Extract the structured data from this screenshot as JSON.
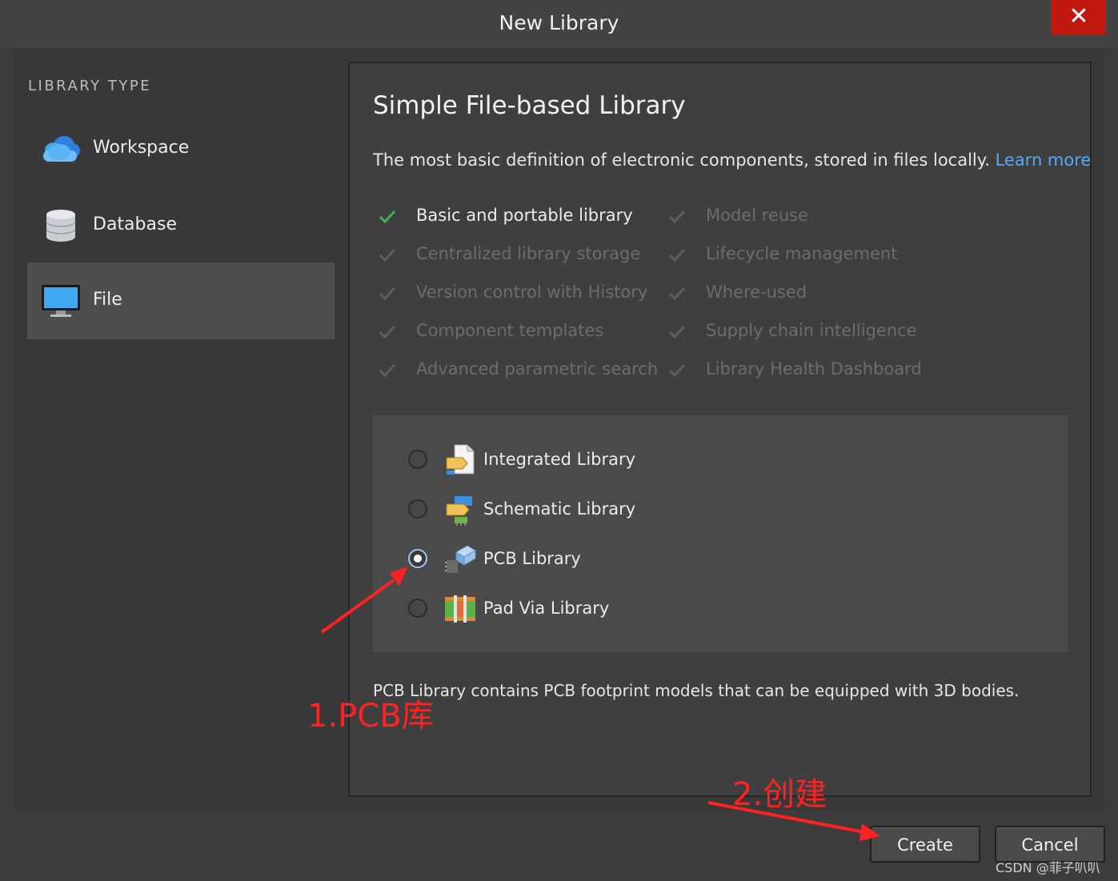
{
  "window": {
    "title": "New Library",
    "close_glyph": "✕"
  },
  "sidebar": {
    "heading": "LIBRARY TYPE",
    "items": [
      {
        "label": "Workspace",
        "icon": "cloud-icon",
        "selected": false
      },
      {
        "label": "Database",
        "icon": "database-icon",
        "selected": false
      },
      {
        "label": "File",
        "icon": "monitor-icon",
        "selected": true
      }
    ]
  },
  "panel": {
    "title": "Simple File-based Library",
    "description": "The most basic definition of electronic components, stored in files locally.",
    "learn_more": "Learn more",
    "features_left": [
      {
        "label": "Basic and portable library",
        "enabled": true
      },
      {
        "label": "Centralized library storage",
        "enabled": false
      },
      {
        "label": "Version control with History",
        "enabled": false
      },
      {
        "label": "Component templates",
        "enabled": false
      },
      {
        "label": "Advanced parametric search",
        "enabled": false
      }
    ],
    "features_right": [
      {
        "label": "Model reuse",
        "enabled": false
      },
      {
        "label": "Lifecycle management",
        "enabled": false
      },
      {
        "label": "Where-used",
        "enabled": false
      },
      {
        "label": "Supply chain intelligence",
        "enabled": false
      },
      {
        "label": "Library Health Dashboard",
        "enabled": false
      }
    ],
    "options": [
      {
        "label": "Integrated Library",
        "icon": "integrated-library-icon",
        "selected": false
      },
      {
        "label": "Schematic Library",
        "icon": "schematic-library-icon",
        "selected": false
      },
      {
        "label": "PCB Library",
        "icon": "pcb-library-icon",
        "selected": true
      },
      {
        "label": "Pad Via Library",
        "icon": "pad-via-library-icon",
        "selected": false
      }
    ],
    "option_description": "PCB Library contains PCB footprint models that can be equipped with 3D bodies."
  },
  "buttons": {
    "create": "Create",
    "cancel": "Cancel"
  },
  "annotations": {
    "step1": "1.PCB库",
    "step2": "2.创建",
    "color": "#ff2222"
  },
  "watermark": "CSDN @菲子叭叭",
  "colors": {
    "accent_link": "#5aa8ee",
    "check_enabled": "#3fb34f",
    "close_bg": "#c0170f"
  }
}
